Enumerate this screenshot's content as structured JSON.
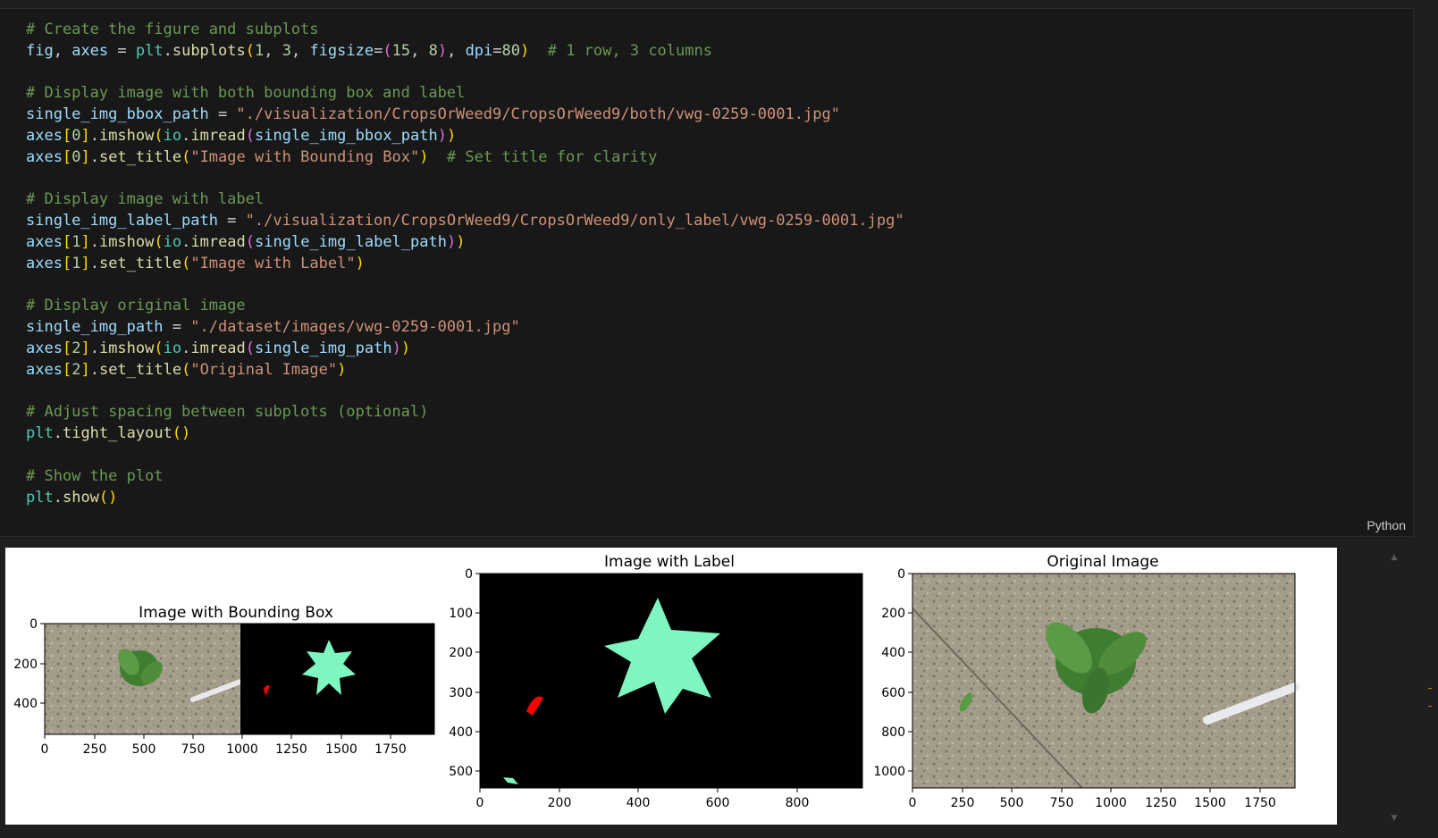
{
  "cell": {
    "language": "Python",
    "lines": [
      [
        {
          "t": "# Create the figure and subplots",
          "c": "comment"
        }
      ],
      [
        {
          "t": "fig",
          "c": "var"
        },
        {
          "t": ", ",
          "c": "op"
        },
        {
          "t": "axes",
          "c": "var"
        },
        {
          "t": " = ",
          "c": "op"
        },
        {
          "t": "plt",
          "c": "mod"
        },
        {
          "t": ".",
          "c": "op"
        },
        {
          "t": "subplots",
          "c": "fn"
        },
        {
          "t": "(",
          "c": "p1"
        },
        {
          "t": "1",
          "c": "num"
        },
        {
          "t": ", ",
          "c": "op"
        },
        {
          "t": "3",
          "c": "num"
        },
        {
          "t": ", ",
          "c": "op"
        },
        {
          "t": "figsize",
          "c": "var"
        },
        {
          "t": "=",
          "c": "op"
        },
        {
          "t": "(",
          "c": "p2"
        },
        {
          "t": "15",
          "c": "num"
        },
        {
          "t": ", ",
          "c": "op"
        },
        {
          "t": "8",
          "c": "num"
        },
        {
          "t": ")",
          "c": "p2"
        },
        {
          "t": ", ",
          "c": "op"
        },
        {
          "t": "dpi",
          "c": "var"
        },
        {
          "t": "=",
          "c": "op"
        },
        {
          "t": "80",
          "c": "num"
        },
        {
          "t": ")",
          "c": "p1"
        },
        {
          "t": "  # 1 row, 3 columns",
          "c": "comment"
        }
      ],
      [],
      [
        {
          "t": "# Display image with both bounding box and label",
          "c": "comment"
        }
      ],
      [
        {
          "t": "single_img_bbox_path",
          "c": "var"
        },
        {
          "t": " = ",
          "c": "op"
        },
        {
          "t": "\"./visualization/CropsOrWeed9/CropsOrWeed9/both/vwg-0259-0001.jpg\"",
          "c": "str"
        }
      ],
      [
        {
          "t": "axes",
          "c": "var"
        },
        {
          "t": "[",
          "c": "p1"
        },
        {
          "t": "0",
          "c": "num"
        },
        {
          "t": "]",
          "c": "p1"
        },
        {
          "t": ".",
          "c": "op"
        },
        {
          "t": "imshow",
          "c": "fn"
        },
        {
          "t": "(",
          "c": "p1"
        },
        {
          "t": "io",
          "c": "mod"
        },
        {
          "t": ".",
          "c": "op"
        },
        {
          "t": "imread",
          "c": "fn"
        },
        {
          "t": "(",
          "c": "p2"
        },
        {
          "t": "single_img_bbox_path",
          "c": "var"
        },
        {
          "t": ")",
          "c": "p2"
        },
        {
          "t": ")",
          "c": "p1"
        }
      ],
      [
        {
          "t": "axes",
          "c": "var"
        },
        {
          "t": "[",
          "c": "p1"
        },
        {
          "t": "0",
          "c": "num"
        },
        {
          "t": "]",
          "c": "p1"
        },
        {
          "t": ".",
          "c": "op"
        },
        {
          "t": "set_title",
          "c": "fn"
        },
        {
          "t": "(",
          "c": "p1"
        },
        {
          "t": "\"Image with Bounding Box\"",
          "c": "str"
        },
        {
          "t": ")",
          "c": "p1"
        },
        {
          "t": "  # Set title for clarity",
          "c": "comment"
        }
      ],
      [],
      [
        {
          "t": "# Display image with label",
          "c": "comment"
        }
      ],
      [
        {
          "t": "single_img_label_path",
          "c": "var"
        },
        {
          "t": " = ",
          "c": "op"
        },
        {
          "t": "\"./visualization/CropsOrWeed9/CropsOrWeed9/only_label/vwg-0259-0001.jpg\"",
          "c": "str"
        }
      ],
      [
        {
          "t": "axes",
          "c": "var"
        },
        {
          "t": "[",
          "c": "p1"
        },
        {
          "t": "1",
          "c": "num"
        },
        {
          "t": "]",
          "c": "p1"
        },
        {
          "t": ".",
          "c": "op"
        },
        {
          "t": "imshow",
          "c": "fn"
        },
        {
          "t": "(",
          "c": "p1"
        },
        {
          "t": "io",
          "c": "mod"
        },
        {
          "t": ".",
          "c": "op"
        },
        {
          "t": "imread",
          "c": "fn"
        },
        {
          "t": "(",
          "c": "p2"
        },
        {
          "t": "single_img_label_path",
          "c": "var"
        },
        {
          "t": ")",
          "c": "p2"
        },
        {
          "t": ")",
          "c": "p1"
        }
      ],
      [
        {
          "t": "axes",
          "c": "var"
        },
        {
          "t": "[",
          "c": "p1"
        },
        {
          "t": "1",
          "c": "num"
        },
        {
          "t": "]",
          "c": "p1"
        },
        {
          "t": ".",
          "c": "op"
        },
        {
          "t": "set_title",
          "c": "fn"
        },
        {
          "t": "(",
          "c": "p1"
        },
        {
          "t": "\"Image with Label\"",
          "c": "str"
        },
        {
          "t": ")",
          "c": "p1"
        }
      ],
      [],
      [
        {
          "t": "# Display original image",
          "c": "comment"
        }
      ],
      [
        {
          "t": "single_img_path",
          "c": "var"
        },
        {
          "t": " = ",
          "c": "op"
        },
        {
          "t": "\"./dataset/images/vwg-0259-0001.jpg\"",
          "c": "str"
        }
      ],
      [
        {
          "t": "axes",
          "c": "var"
        },
        {
          "t": "[",
          "c": "p1"
        },
        {
          "t": "2",
          "c": "num"
        },
        {
          "t": "]",
          "c": "p1"
        },
        {
          "t": ".",
          "c": "op"
        },
        {
          "t": "imshow",
          "c": "fn"
        },
        {
          "t": "(",
          "c": "p1"
        },
        {
          "t": "io",
          "c": "mod"
        },
        {
          "t": ".",
          "c": "op"
        },
        {
          "t": "imread",
          "c": "fn"
        },
        {
          "t": "(",
          "c": "p2"
        },
        {
          "t": "single_img_path",
          "c": "var"
        },
        {
          "t": ")",
          "c": "p2"
        },
        {
          "t": ")",
          "c": "p1"
        }
      ],
      [
        {
          "t": "axes",
          "c": "var"
        },
        {
          "t": "[",
          "c": "p1"
        },
        {
          "t": "2",
          "c": "num"
        },
        {
          "t": "]",
          "c": "p1"
        },
        {
          "t": ".",
          "c": "op"
        },
        {
          "t": "set_title",
          "c": "fn"
        },
        {
          "t": "(",
          "c": "p1"
        },
        {
          "t": "\"Original Image\"",
          "c": "str"
        },
        {
          "t": ")",
          "c": "p1"
        }
      ],
      [],
      [
        {
          "t": "# Adjust spacing between subplots (optional)",
          "c": "comment"
        }
      ],
      [
        {
          "t": "plt",
          "c": "mod"
        },
        {
          "t": ".",
          "c": "op"
        },
        {
          "t": "tight_layout",
          "c": "fn"
        },
        {
          "t": "()",
          "c": "p1"
        }
      ],
      [],
      [
        {
          "t": "# Show the plot",
          "c": "comment"
        }
      ],
      [
        {
          "t": "plt",
          "c": "mod"
        },
        {
          "t": ".",
          "c": "op"
        },
        {
          "t": "show",
          "c": "fn"
        },
        {
          "t": "()",
          "c": "p1"
        }
      ]
    ]
  },
  "output": {
    "panels": [
      {
        "title": "Image with Bounding Box",
        "image": "bbox-and-label-side-by-side",
        "x_ticks": [
          "0",
          "250",
          "500",
          "750",
          "1000",
          "1250",
          "1500",
          "1750"
        ],
        "y_ticks": [
          "0",
          "200",
          "400"
        ]
      },
      {
        "title": "Image with Label",
        "image": "label-mask",
        "x_ticks": [
          "0",
          "200",
          "400",
          "600",
          "800"
        ],
        "y_ticks": [
          "0",
          "100",
          "200",
          "300",
          "400",
          "500"
        ]
      },
      {
        "title": "Original Image",
        "image": "original-photo",
        "x_ticks": [
          "0",
          "250",
          "500",
          "750",
          "1000",
          "1250",
          "1500",
          "1750"
        ],
        "y_ticks": [
          "0",
          "200",
          "400",
          "600",
          "800",
          "1000"
        ]
      }
    ],
    "colors": {
      "soil": "#a39a88",
      "plant": "#4a8a3a",
      "mask_crop": "#7ff5c0",
      "mask_weed": "#ff0000",
      "mask_bg": "#000000"
    }
  }
}
